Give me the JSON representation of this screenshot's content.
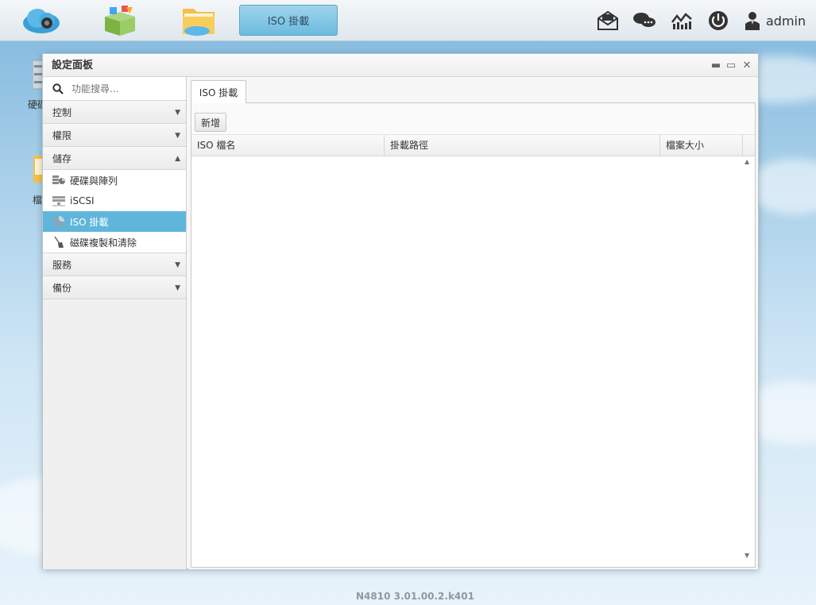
{
  "taskbar": {
    "apps": [
      {
        "name": "cloud-app",
        "icon": "cloud-icon"
      },
      {
        "name": "app-center",
        "icon": "app-box-icon"
      },
      {
        "name": "file-manager",
        "icon": "folder-icon"
      }
    ],
    "active_app_label": "ISO 掛載",
    "right_icons": [
      "mail-icon",
      "chat-icon",
      "monitor-icon",
      "power-icon"
    ],
    "user": "admin"
  },
  "desktop": {
    "icon1_label": "硬碟",
    "icon2_label": "檔"
  },
  "window": {
    "title": "設定面板",
    "controls": {
      "minimize": "▬",
      "maximize": "▭",
      "close": "✕"
    }
  },
  "sidebar": {
    "search_placeholder": "功能搜尋...",
    "categories": [
      {
        "label": "控制",
        "arrow": "▼"
      },
      {
        "label": "權限",
        "arrow": "▼"
      },
      {
        "label": "儲存",
        "arrow": "▲"
      }
    ],
    "storage_items": [
      {
        "label": "硬碟與陣列",
        "icon": "disk-array-icon"
      },
      {
        "label": "iSCSI",
        "icon": "iscsi-icon"
      },
      {
        "label": "ISO 掛載",
        "icon": "iso-disc-icon"
      },
      {
        "label": "磁碟複製和清除",
        "icon": "broom-icon"
      }
    ],
    "categories_after": [
      {
        "label": "服務",
        "arrow": "▼"
      },
      {
        "label": "備份",
        "arrow": "▼"
      }
    ]
  },
  "main": {
    "tab_label": "ISO 掛載",
    "add_button": "新增",
    "columns": [
      "ISO 檔名",
      "掛載路徑",
      "檔案大小"
    ]
  },
  "footer": {
    "version": "N4810   3.01.00.2.k401"
  },
  "colors": {
    "accent": "#5fb6da",
    "active_tab": "#7fc4e4"
  }
}
